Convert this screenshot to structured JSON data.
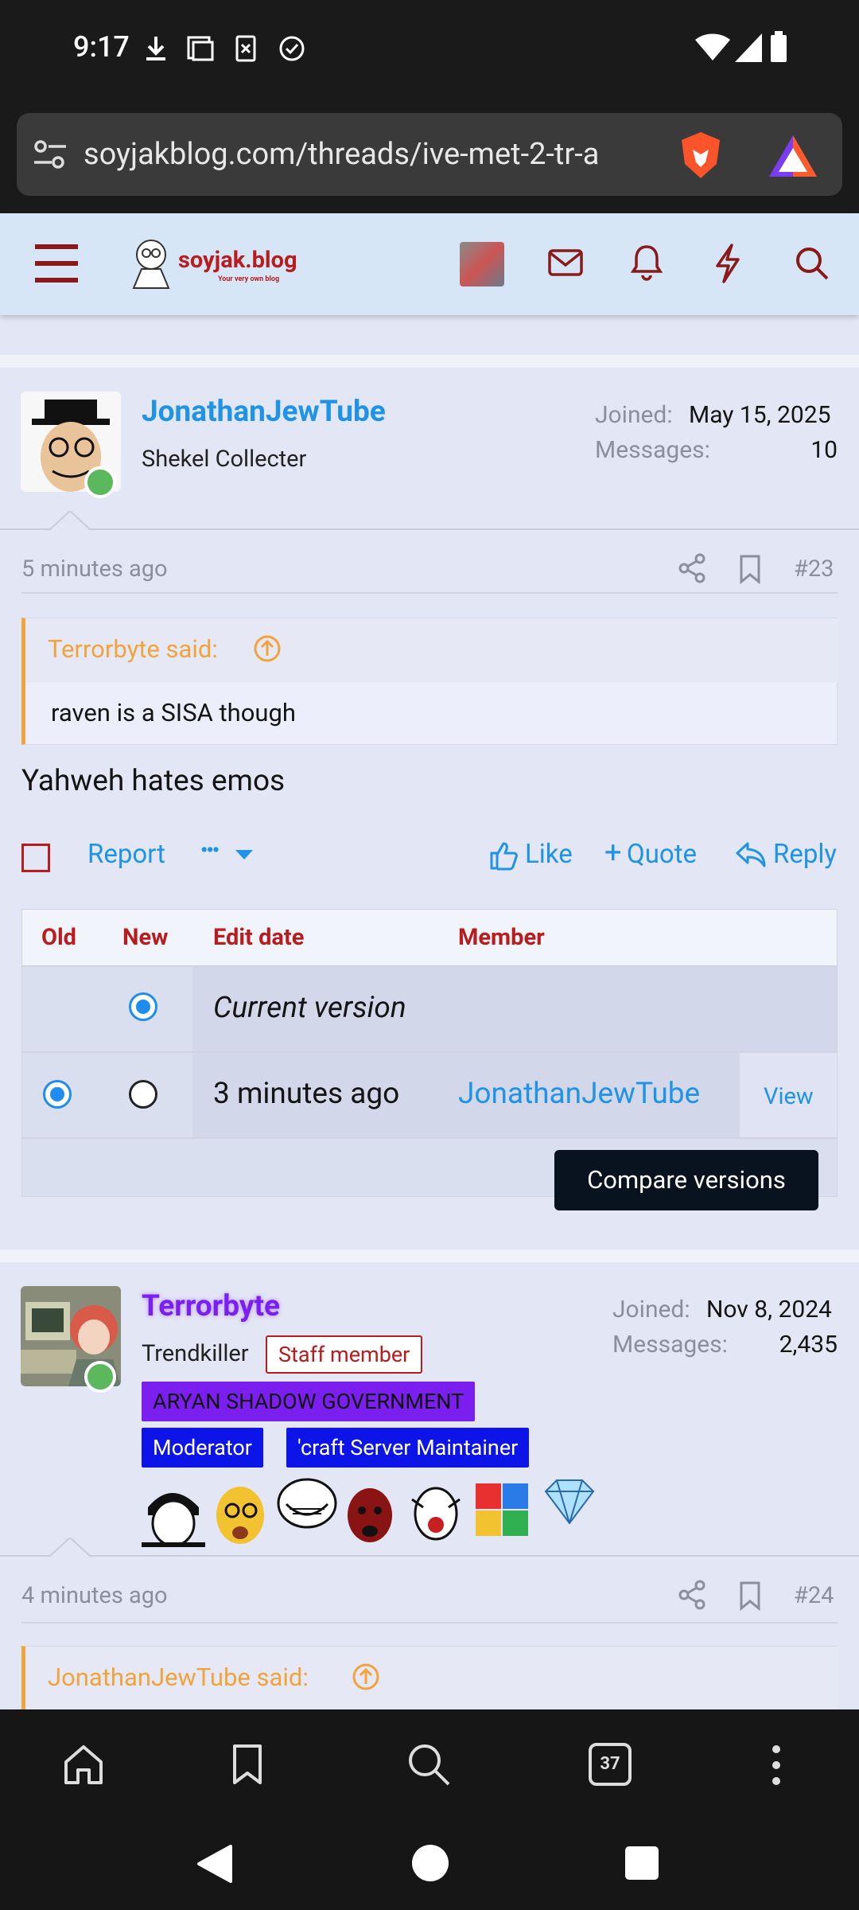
{
  "status_bar": {
    "time": "9:17"
  },
  "browser": {
    "url": "soyjakblog.com/threads/ive-met-2-tr-a",
    "tab_count": "37"
  },
  "site": {
    "logo_text": "soyjak.blog",
    "logo_tagline": "Your very own blog"
  },
  "post23": {
    "username": "JonathanJewTube",
    "user_title": "Shekel Collecter",
    "joined_label": "Joined:",
    "joined_value": "May 15, 2025",
    "messages_label": "Messages:",
    "messages_value": "10",
    "time": "5 minutes ago",
    "number": "#23",
    "quote_author": "Terrorbyte said:",
    "quote_text": "raven is a SISA though",
    "body": "Yahweh hates emos",
    "actions": {
      "report": "Report",
      "more": "•••",
      "like": "Like",
      "quote": "Quote",
      "reply": "Reply"
    },
    "history": {
      "headers": {
        "old": "Old",
        "new": "New",
        "edit_date": "Edit date",
        "member": "Member"
      },
      "current_version": "Current version",
      "row2_date": "3 minutes ago",
      "row2_member": "JonathanJewTube",
      "row2_view": "View",
      "compare_button": "Compare versions"
    }
  },
  "post24": {
    "username": "Terrorbyte",
    "user_title": "Trendkiller",
    "staff_badge": "Staff member",
    "banner1": "ARYAN SHADOW GOVERNMENT",
    "banner2": "Moderator",
    "banner3": "'craft Server Maintainer",
    "joined_label": "Joined:",
    "joined_value": "Nov 8, 2024",
    "messages_label": "Messages:",
    "messages_value": "2,435",
    "time": "4 minutes ago",
    "number": "#24",
    "quote_author": "JonathanJewTube said:"
  },
  "colors": {
    "accent": "#1f93e6",
    "brand_red": "#b81c1c",
    "quote_orange": "#f0a43b",
    "purple": "#7a1ff0"
  }
}
